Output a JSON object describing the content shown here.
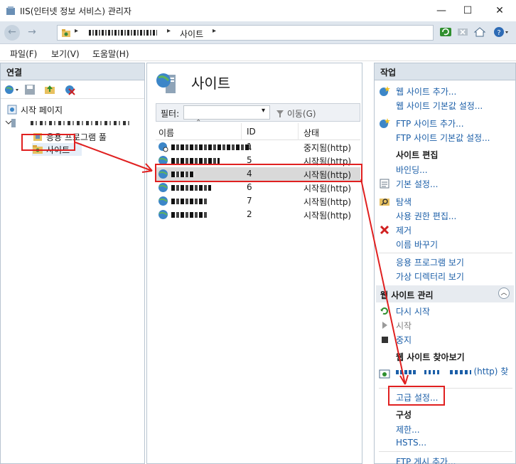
{
  "window": {
    "title": "IIS(인터넷 정보 서비스) 관리자",
    "minimize": "—",
    "maximize": "☐",
    "close": "✕"
  },
  "address": {
    "back": "←",
    "forward": "→",
    "crumb_sep": "▸",
    "crumb_sites": "사이트"
  },
  "menu": {
    "file": "파일(F)",
    "view": "보기(V)",
    "help": "도움말(H)"
  },
  "connections": {
    "header": "연결",
    "tree": {
      "start_page": "시작 페이지",
      "app_pools": "응용 프로그램 풀",
      "sites": "사이트"
    }
  },
  "center": {
    "title": "사이트",
    "filter_label": "필터:",
    "go_label": "이동(G)",
    "columns": {
      "name": "이름",
      "id": "ID",
      "status": "상태"
    },
    "rows": [
      {
        "id": "1",
        "status": "중지됨(http)",
        "selected": false
      },
      {
        "id": "5",
        "status": "시작됨(http)",
        "selected": false
      },
      {
        "id": "4",
        "status": "시작됨(http)",
        "selected": true
      },
      {
        "id": "6",
        "status": "시작됨(http)",
        "selected": false
      },
      {
        "id": "7",
        "status": "시작됨(http)",
        "selected": false
      },
      {
        "id": "2",
        "status": "시작됨(http)",
        "selected": false
      }
    ]
  },
  "actions": {
    "header": "작업",
    "add_website": "웹 사이트 추가...",
    "website_defaults": "웹 사이트 기본값 설정...",
    "add_ftp": "FTP 사이트 추가...",
    "ftp_defaults": "FTP 사이트 기본값 설정...",
    "edit_site": "사이트 편집",
    "bindings": "바인딩...",
    "basic_settings": "기본 설정...",
    "explore": "탐색",
    "edit_permissions": "사용 권한 편집...",
    "remove": "제거",
    "rename": "이름 바꾸기",
    "view_apps": "응용 프로그램 보기",
    "view_vdirs": "가상 디렉터리 보기",
    "manage_site": "웹 사이트 관리",
    "restart": "다시 시작",
    "start": "시작",
    "stop": "중지",
    "browse_site": "웹 사이트 찾아보기",
    "browse_suffix": "(http) 찾",
    "advanced_settings": "고급 설정...",
    "configure": "구성",
    "limits": "제한...",
    "hsts": "HSTS...",
    "add_ftp_publishing": "FTP 게시 추가..."
  },
  "colors": {
    "link": "#1c5fa8",
    "highlight": "#e02020",
    "pane_header": "#dbe3eb",
    "selected_row": "#d9d9d9"
  }
}
